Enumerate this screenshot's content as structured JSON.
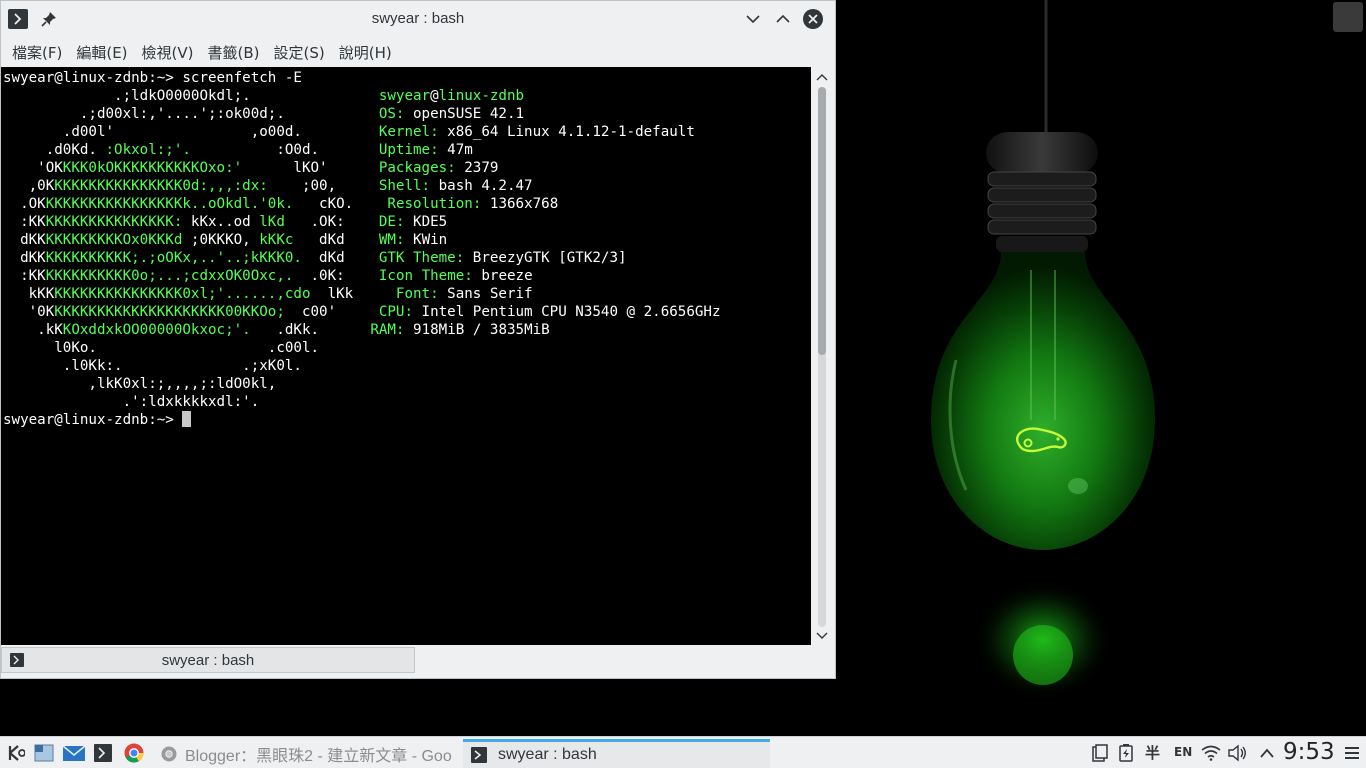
{
  "window": {
    "title": "swyear : bash",
    "tab_label": "swyear : bash"
  },
  "menu": [
    "檔案(F)",
    "編輯(E)",
    "檢視(V)",
    "書籤(B)",
    "設定(S)",
    "說明(H)"
  ],
  "terminal": {
    "prompt_command": "swyear@linux-zdnb:~> screenfetch -E",
    "prompt_final": "swyear@linux-zdnb:~> ",
    "user": "swyear",
    "at": "@",
    "host": "linux-zdnb",
    "info": [
      {
        "key": "OS:",
        "value": " openSUSE 42.1"
      },
      {
        "key": "Kernel:",
        "value": " x86_64 Linux 4.1.12-1-default"
      },
      {
        "key": "Uptime:",
        "value": " 47m"
      },
      {
        "key": "Packages:",
        "value": " 2379"
      },
      {
        "key": "Shell:",
        "value": " bash 4.2.47"
      },
      {
        "key": "Resolution:",
        "value": " 1366x768"
      },
      {
        "key": "DE:",
        "value": " KDE5"
      },
      {
        "key": "WM:",
        "value": " KWin"
      },
      {
        "key": "GTK Theme:",
        "value": " BreezyGTK [GTK2/3]"
      },
      {
        "key": "Icon Theme:",
        "value": " breeze"
      },
      {
        "key": "Font:",
        "value": " Sans Serif"
      },
      {
        "key": "CPU:",
        "value": " Intel Pentium CPU N3540 @ 2.6656GHz"
      },
      {
        "key": "RAM:",
        "value": " 918MiB / 3835MiB"
      }
    ],
    "ascii": [
      [
        [
          "w",
          "             .;ldkO0000Okdl;.               "
        ]
      ],
      [
        [
          "w",
          "         .;d00xl:,'....';:ok00d;.           "
        ]
      ],
      [
        [
          "w",
          "       .d00l'                ,o00d.         "
        ]
      ],
      [
        [
          "w",
          "     .d0Kd. "
        ],
        [
          "g",
          ":Okxol:;'."
        ],
        [
          "w",
          "          :O0d.       "
        ]
      ],
      [
        [
          "w",
          "    'OK"
        ],
        [
          "g",
          "KKK0kOKKKKKKKKKKOxo:'"
        ],
        [
          "w",
          "      lKO'      "
        ]
      ],
      [
        [
          "w",
          "   ,0K"
        ],
        [
          "g",
          "KKKKKKKKKKKKKKK0d:,,,:dx:"
        ],
        [
          "w",
          "    ;00,     "
        ]
      ],
      [
        [
          "w",
          "  .OK"
        ],
        [
          "g",
          "KKKKKKKKKKKKKKKKk..oOkdl.'0k."
        ],
        [
          "w",
          "   cKO.    "
        ]
      ],
      [
        [
          "w",
          "  :KK"
        ],
        [
          "g",
          "KKKKKKKKKKKKKKK:"
        ],
        [
          "w",
          " kKx..od "
        ],
        [
          "g",
          "lKd"
        ],
        [
          "w",
          "   .OK:    "
        ]
      ],
      [
        [
          "w",
          "  dKK"
        ],
        [
          "g",
          "KKKKKKKKKOx0KKKd"
        ],
        [
          "w",
          " ;0KKKO, "
        ],
        [
          "g",
          "kKKc"
        ],
        [
          "w",
          "   dKd    "
        ]
      ],
      [
        [
          "w",
          "  dKK"
        ],
        [
          "g",
          "KKKKKKKKKK;.;oOKx,..'..;kKKK0."
        ],
        [
          "w",
          "  dKd    "
        ]
      ],
      [
        [
          "w",
          "  :KK"
        ],
        [
          "g",
          "KKKKKKKKKK0o;...;cdxxOK0Oxc,."
        ],
        [
          "w",
          "  .0K:    "
        ]
      ],
      [
        [
          "w",
          "   kKK"
        ],
        [
          "g",
          "KKKKKKKKKKKKKKK0xl;'......,cdo"
        ],
        [
          "w",
          "  lKk     "
        ]
      ],
      [
        [
          "w",
          "   '0K"
        ],
        [
          "g",
          "KKKKKKKKKKKKKKKKKKKK00KKOo;"
        ],
        [
          "w",
          "  c00'     "
        ]
      ],
      [
        [
          "w",
          "    .kK"
        ],
        [
          "g",
          "KOxddxkOO00000Okxoc;'."
        ],
        [
          "w",
          "   .dKk.      "
        ]
      ],
      [
        [
          "w",
          "      l0Ko.                    .c00l.       "
        ]
      ],
      [
        [
          "w",
          "       .l0Kk:.              .;xK0l.         "
        ]
      ],
      [
        [
          "w",
          "          ,lkK0xl:;,,,,;:ldO0kl,            "
        ]
      ],
      [
        [
          "w",
          "              .':ldxkkkkxdl:'.              "
        ]
      ]
    ]
  },
  "taskbar": {
    "tasks": [
      {
        "label": "Blogger：黑眼珠2 - 建立新文章 - Goo"
      },
      {
        "label": "swyear : bash"
      }
    ],
    "tray_ime": "半",
    "tray_lang": "EN",
    "clock": "9:53"
  }
}
